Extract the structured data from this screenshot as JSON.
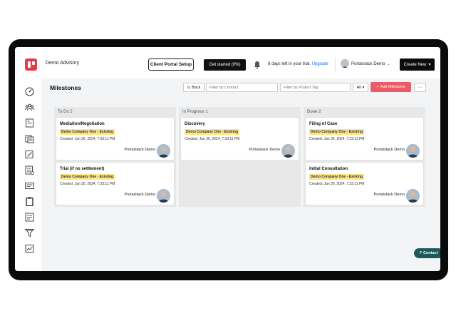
{
  "header": {
    "company": "Demo Advisory",
    "client_portal_label": "Client Portal Setup",
    "get_started_label": "Get started (0%)",
    "trial_text": "8 days left in your trial.",
    "upgrade_label": "Upgrade",
    "user_name": "Portalstack Demo",
    "create_new_label": "Create New"
  },
  "toolbar": {
    "title": "Milestones",
    "back_label": "Back",
    "filter_contact_placeholder": "Filter by Contact",
    "filter_project_placeholder": "Filter by Project Tag",
    "all_label": "All",
    "add_milestone_label": "Add Milestone",
    "more_label": "···"
  },
  "columns": [
    {
      "name": "To Do 2",
      "cards": [
        {
          "title": "Mediation/Negotiation",
          "tag": "Demo Company One - Existing",
          "created": "Created: Jan 30, 2024, 7:33:11 PM",
          "owner": "Portalstack Demo"
        },
        {
          "title": "Trial (if no settlement)",
          "tag": "Demo Company One - Existing",
          "created": "Created: Jan 30, 2024, 7:33:11 PM",
          "owner": "Portalstack Demo"
        }
      ]
    },
    {
      "name": "In Progress 1",
      "cards": [
        {
          "title": "Discovery",
          "tag": "Demo Company One - Existing",
          "created": "Created: Jan 30, 2024, 7:33:11 PM",
          "owner": "Portalstack Demo"
        }
      ]
    },
    {
      "name": "Done 2",
      "cards": [
        {
          "title": "Filing of Case",
          "tag": "Demo Company One - Existing",
          "created": "Created: Jan 30, 2024, 7:33:11 PM",
          "owner": "Portalstack Demo"
        },
        {
          "title": "Initial Consultation",
          "tag": "Demo Company One - Existing",
          "created": "Created: Jan 30, 2024, 7:33:11 PM",
          "owner": "Portalstack Demo"
        }
      ]
    }
  ],
  "sidebar": {
    "icons": [
      "dashboard-icon",
      "contacts-icon",
      "pages-icon",
      "documents-icon",
      "edit-icon",
      "checklist-icon",
      "forms-icon",
      "clipboard-icon",
      "invoice-icon",
      "funnel-icon",
      "reports-icon"
    ]
  },
  "contact_button": {
    "label": "Contact"
  },
  "colors": {
    "brand": "#e53945",
    "add_button": "#ec5a66",
    "tag_bg": "#fde68a",
    "contact_bg": "#1f5a5a",
    "frame": "#0a0a0a"
  }
}
